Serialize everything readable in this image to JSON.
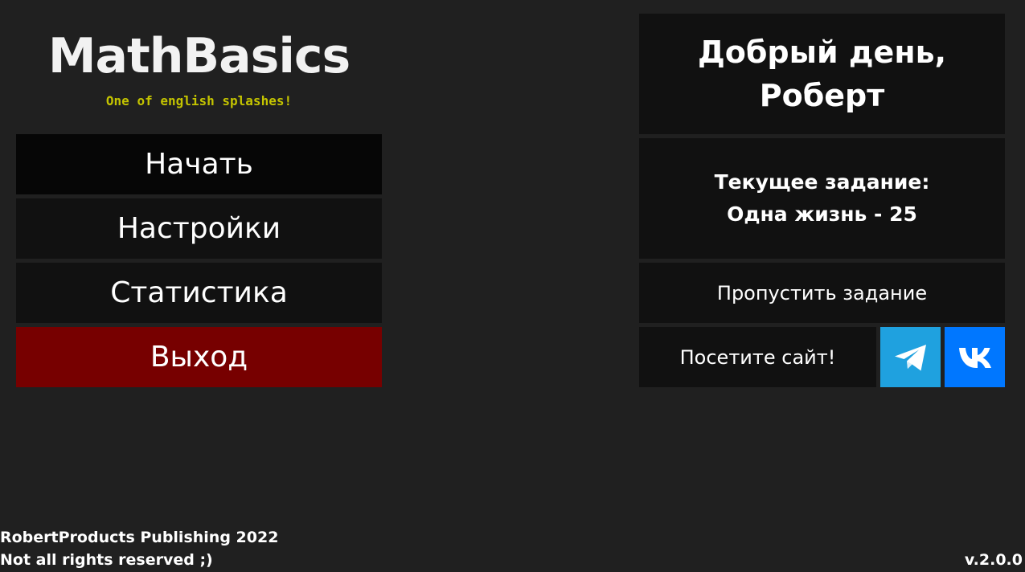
{
  "app": {
    "title": "MathBasics",
    "splash": "One of english splashes!"
  },
  "menu": {
    "start": "Начать",
    "settings": "Настройки",
    "statistics": "Статистика",
    "exit": "Выход"
  },
  "greeting": {
    "line1": "Добрый день,",
    "line2": "Роберт"
  },
  "task": {
    "heading": "Текущее задание:",
    "name": "Одна жизнь - 25"
  },
  "actions": {
    "skip_task": "Пропустить задание",
    "visit_site": "Посетите сайт!"
  },
  "social": {
    "telegram_icon": "telegram-icon",
    "vk_icon": "vk-icon"
  },
  "footer": {
    "line1": "RobertProducts Publishing 2022",
    "line2": "Not all rights reserved ;)",
    "version": "v.2.0.0"
  },
  "colors": {
    "background": "#202020",
    "panel": "#111111",
    "exit": "#770000",
    "splash": "#c4c400",
    "telegram": "#1fa1df",
    "vk": "#0077ff"
  }
}
